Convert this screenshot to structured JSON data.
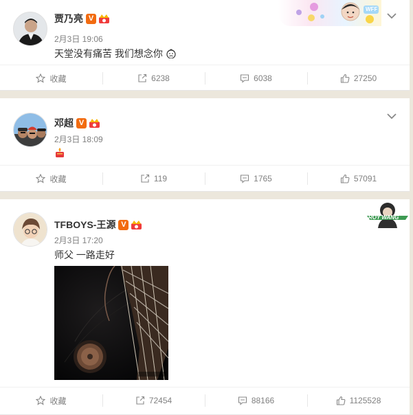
{
  "posts": [
    {
      "author": "贾乃亮",
      "verified_badge": "V",
      "date": "2月3日 19:06",
      "text": "天堂没有痛苦  我们想念你",
      "decoration": "WFF",
      "actions": {
        "favorite": "收藏",
        "repost": "6238",
        "comment": "6038",
        "like": "27250"
      }
    },
    {
      "author": "邓超",
      "verified_badge": "V",
      "date": "2月3日 18:09",
      "text": "",
      "actions": {
        "favorite": "收藏",
        "repost": "119",
        "comment": "1765",
        "like": "57091"
      }
    },
    {
      "author": "TFBOYS-王源",
      "verified_badge": "V",
      "date": "2月3日 17:20",
      "text": "师父 一路走好",
      "decoration": "ROY WANG",
      "actions": {
        "favorite": "收藏",
        "repost": "72454",
        "comment": "88166",
        "like": "1125528"
      }
    }
  ],
  "colors": {
    "accent": "#f26b10",
    "background": "#ece7dc",
    "meta_text": "#808080"
  }
}
